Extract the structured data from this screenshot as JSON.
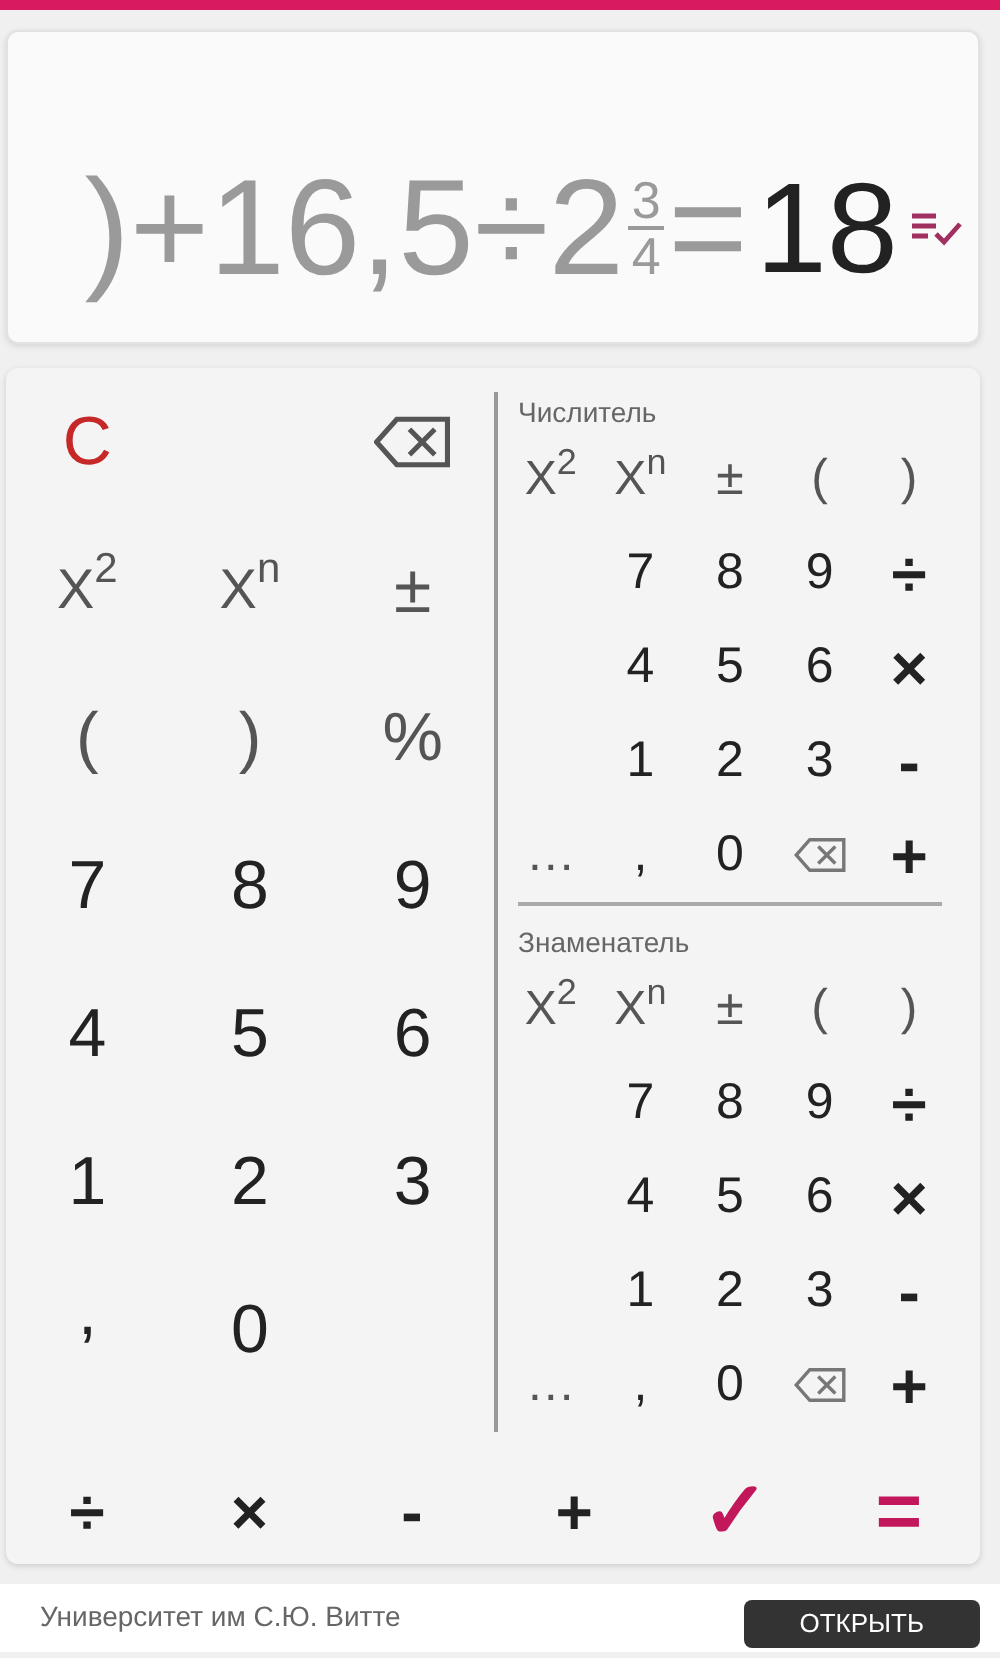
{
  "display": {
    "expression": ")+16,5÷2",
    "fraction": {
      "numerator": "3",
      "denominator": "4"
    },
    "equals": "=",
    "result": "18"
  },
  "keypad": {
    "keys": [
      {
        "kind": "clear",
        "label": "C"
      },
      {
        "kind": "blank"
      },
      {
        "kind": "backspace"
      },
      {
        "kind": "power",
        "label": "X$^{2}$"
      },
      {
        "kind": "power",
        "label": "X$^{n}$"
      },
      {
        "kind": "func",
        "label": "±"
      },
      {
        "kind": "func",
        "label": "("
      },
      {
        "kind": "func",
        "label": ")"
      },
      {
        "kind": "func",
        "label": "%"
      },
      {
        "kind": "digit",
        "label": "7"
      },
      {
        "kind": "digit",
        "label": "8"
      },
      {
        "kind": "digit",
        "label": "9"
      },
      {
        "kind": "digit",
        "label": "4"
      },
      {
        "kind": "digit",
        "label": "5"
      },
      {
        "kind": "digit",
        "label": "6"
      },
      {
        "kind": "digit",
        "label": "1"
      },
      {
        "kind": "digit",
        "label": "2"
      },
      {
        "kind": "digit",
        "label": "3"
      },
      {
        "kind": "mark",
        "label": ","
      },
      {
        "kind": "digit",
        "label": "0"
      },
      {
        "kind": "blank"
      }
    ],
    "fraction_panels": [
      {
        "label": "Числитель",
        "keys": [
          {
            "kind": "power",
            "label": "X$^{2}$"
          },
          {
            "kind": "power",
            "label": "X$^{n}$"
          },
          {
            "kind": "func",
            "label": "±"
          },
          {
            "kind": "func",
            "label": "("
          },
          {
            "kind": "func",
            "label": ")"
          },
          {
            "kind": "blank"
          },
          {
            "kind": "digit",
            "label": "7"
          },
          {
            "kind": "digit",
            "label": "8"
          },
          {
            "kind": "digit",
            "label": "9"
          },
          {
            "kind": "op",
            "label": "÷"
          },
          {
            "kind": "blank"
          },
          {
            "kind": "digit",
            "label": "4"
          },
          {
            "kind": "digit",
            "label": "5"
          },
          {
            "kind": "digit",
            "label": "6"
          },
          {
            "kind": "op",
            "label": "×"
          },
          {
            "kind": "blank"
          },
          {
            "kind": "digit",
            "label": "1"
          },
          {
            "kind": "digit",
            "label": "2"
          },
          {
            "kind": "digit",
            "label": "3"
          },
          {
            "kind": "op",
            "label": "-"
          },
          {
            "kind": "func",
            "label": "…"
          },
          {
            "kind": "digit",
            "label": ","
          },
          {
            "kind": "digit",
            "label": "0"
          },
          {
            "kind": "backspace"
          },
          {
            "kind": "op",
            "label": "+"
          }
        ]
      },
      {
        "label": "Знаменатель",
        "keys": [
          {
            "kind": "power",
            "label": "X$^{2}$"
          },
          {
            "kind": "power",
            "label": "X$^{n}$"
          },
          {
            "kind": "func",
            "label": "±"
          },
          {
            "kind": "func",
            "label": "("
          },
          {
            "kind": "func",
            "label": ")"
          },
          {
            "kind": "blank"
          },
          {
            "kind": "digit",
            "label": "7"
          },
          {
            "kind": "digit",
            "label": "8"
          },
          {
            "kind": "digit",
            "label": "9"
          },
          {
            "kind": "op",
            "label": "÷"
          },
          {
            "kind": "blank"
          },
          {
            "kind": "digit",
            "label": "4"
          },
          {
            "kind": "digit",
            "label": "5"
          },
          {
            "kind": "digit",
            "label": "6"
          },
          {
            "kind": "op",
            "label": "×"
          },
          {
            "kind": "blank"
          },
          {
            "kind": "digit",
            "label": "1"
          },
          {
            "kind": "digit",
            "label": "2"
          },
          {
            "kind": "digit",
            "label": "3"
          },
          {
            "kind": "op",
            "label": "-"
          },
          {
            "kind": "func",
            "label": "…"
          },
          {
            "kind": "digit",
            "label": ","
          },
          {
            "kind": "digit",
            "label": "0"
          },
          {
            "kind": "backspace"
          },
          {
            "kind": "op",
            "label": "+"
          }
        ]
      }
    ],
    "bottom_keys": [
      {
        "kind": "op",
        "label": "÷"
      },
      {
        "kind": "op",
        "label": "×"
      },
      {
        "kind": "op",
        "label": "-"
      },
      {
        "kind": "op",
        "label": "+"
      },
      {
        "kind": "accent",
        "label": "✓"
      },
      {
        "kind": "accent",
        "label": "="
      }
    ]
  },
  "ad": {
    "text": "Университет им С.Ю. Витте",
    "button": "ОТКРЫТЬ"
  }
}
